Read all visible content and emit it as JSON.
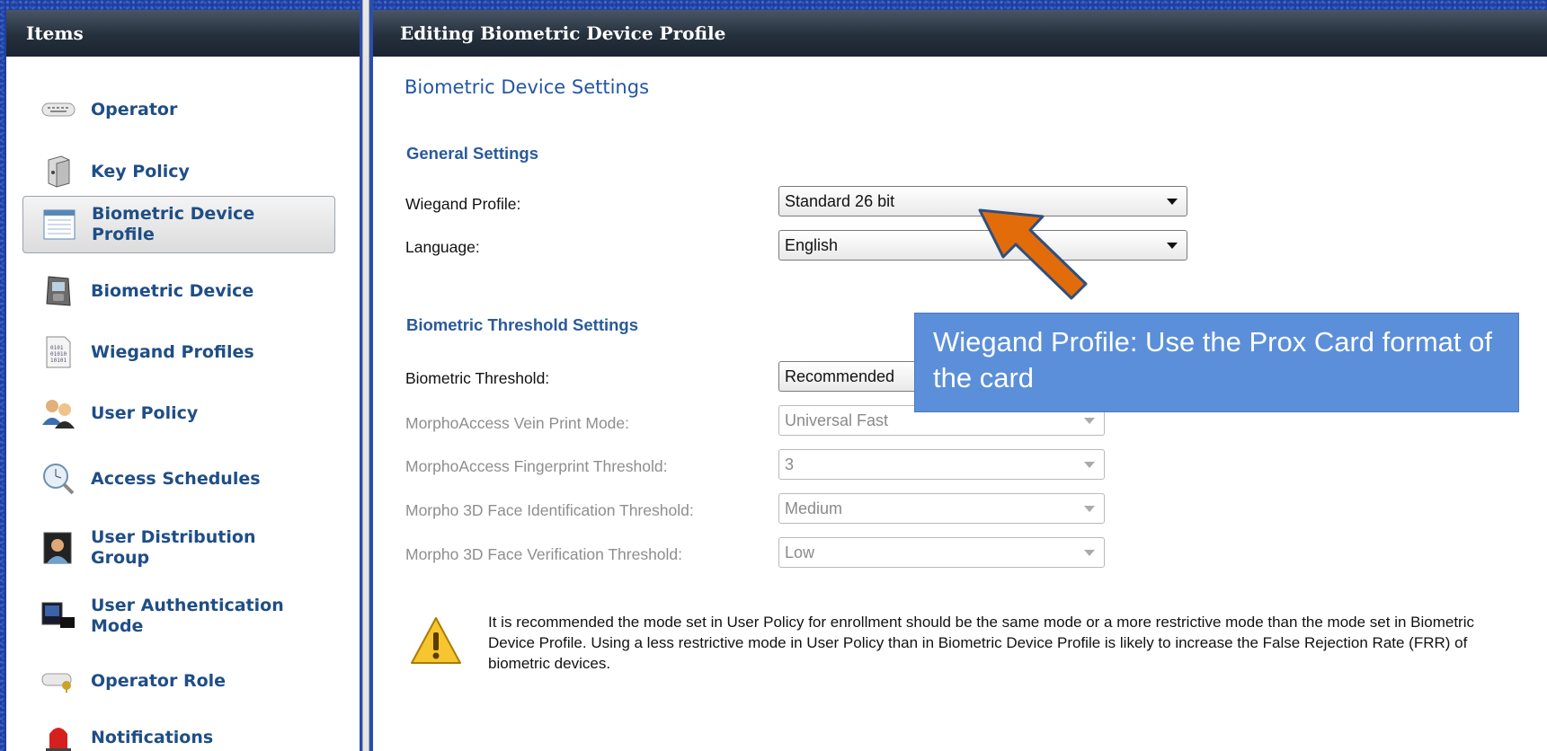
{
  "left_panel": {
    "title": "Items",
    "items": [
      {
        "label": "Operator",
        "icon": "keyboard-icon"
      },
      {
        "label": "Key Policy",
        "icon": "key-box-icon"
      },
      {
        "label": "Biometric Device Profile",
        "icon": "profile-window-icon",
        "selected": true
      },
      {
        "label": "Biometric Device",
        "icon": "biometric-reader-icon"
      },
      {
        "label": "Wiegand Profiles",
        "icon": "binary-document-icon"
      },
      {
        "label": "User Policy",
        "icon": "users-icon"
      },
      {
        "label": "Access Schedules",
        "icon": "clock-search-icon"
      },
      {
        "label": "User Distribution Group",
        "icon": "user-photo-icon"
      },
      {
        "label": "User Authentication Mode",
        "icon": "card-scan-icon"
      },
      {
        "label": "Operator Role",
        "icon": "keyboard-key-icon"
      },
      {
        "label": "Notifications",
        "icon": "alarm-light-icon"
      }
    ]
  },
  "right_panel": {
    "title": "Editing Biometric Device Profile",
    "section_title": "Biometric Device Settings",
    "general": {
      "title": "General Settings",
      "wiegand_label": "Wiegand Profile:",
      "wiegand_value": "Standard 26 bit",
      "language_label": "Language:",
      "language_value": "English"
    },
    "threshold": {
      "title": "Biometric Threshold Settings",
      "threshold_label": "Biometric Threshold:",
      "threshold_value": "Recommended",
      "vein_label": "MorphoAccess Vein Print Mode:",
      "vein_value": "Universal Fast",
      "fingerprint_label": "MorphoAccess Fingerprint Threshold:",
      "fingerprint_value": "3",
      "face_id_label": "Morpho 3D Face Identification Threshold:",
      "face_id_value": "Medium",
      "face_verif_label": "Morpho 3D Face Verification Threshold:",
      "face_verif_value": "Low"
    },
    "warning": "It is recommended the mode set in User Policy for enrollment should be the same mode or a more restrictive mode than the mode set in Biometric Device Profile.  Using a less restrictive mode in User Policy than in Biometric Device Profile is likely to increase the False Rejection Rate (FRR) of biometric devices."
  },
  "callout": {
    "text": "Wiegand Profile: Use the Prox Card format of the card",
    "color": "#5b8fd9",
    "arrow_color": "#e36c0a"
  }
}
